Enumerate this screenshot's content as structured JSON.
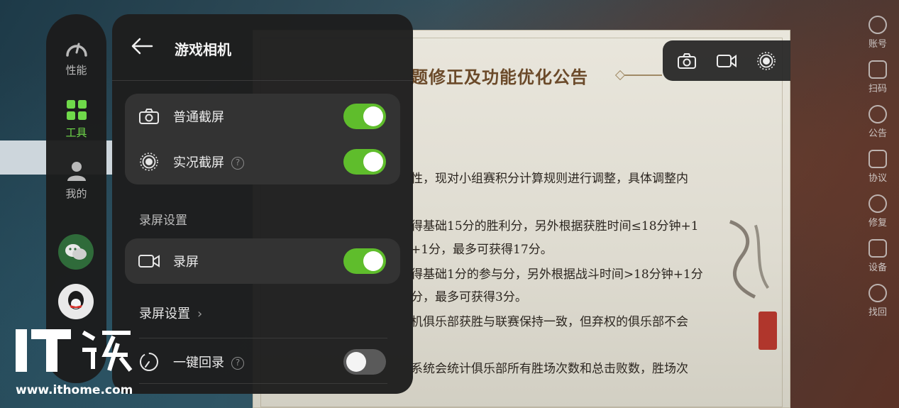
{
  "panel": {
    "title": "游戏相机",
    "screenshot_section": {
      "normal_label": "普通截屏",
      "normal_on": true,
      "live_label": "实况截屏",
      "live_on": true
    },
    "record_section_header": "录屏设置",
    "record_section": {
      "record_label": "录屏",
      "record_on": true
    },
    "record_settings_label": "录屏设置",
    "replay_label": "一键回录",
    "replay_on": false,
    "help_glyph": "?",
    "chevron_glyph": "›"
  },
  "rail": {
    "items": [
      {
        "label": "性能",
        "icon": "gauge-icon"
      },
      {
        "label": "工具",
        "icon": "grid-icon",
        "active": true
      },
      {
        "label": "我的",
        "icon": "person-icon"
      }
    ],
    "apps": [
      "wechat-icon",
      "qq-icon"
    ]
  },
  "quickbar": {
    "buttons": [
      "camera-icon",
      "video-icon",
      "live-photo-icon"
    ]
  },
  "game": {
    "notice_title": "题修正及功能优化公告",
    "lines": [
      "性，现对小组赛积分计算规则进行调整，具体调整内",
      "得基础15分的胜利分，另外根据获胜时间≤18分钟+1",
      "+1分，最多可获得17分。",
      "得基础1分的参与分，另外根据战斗时间>18分钟+1分",
      "分，最多可获得3分。",
      "机俱乐部获胜与联赛保持一致，但弃权的俱乐部不会",
      "系统会统计俱乐部所有胜场次数和总击败数，胜场次"
    ],
    "right_menu": [
      "账号",
      "扫码",
      "公告",
      "协议",
      "修复",
      "设备",
      "找回"
    ]
  },
  "watermark": {
    "logo": "IT之家",
    "url": "www.ithome.com"
  },
  "colors": {
    "accent_green": "#5fbd2c",
    "panel_bg": "#1e1e1e",
    "card_bg": "#333333"
  }
}
